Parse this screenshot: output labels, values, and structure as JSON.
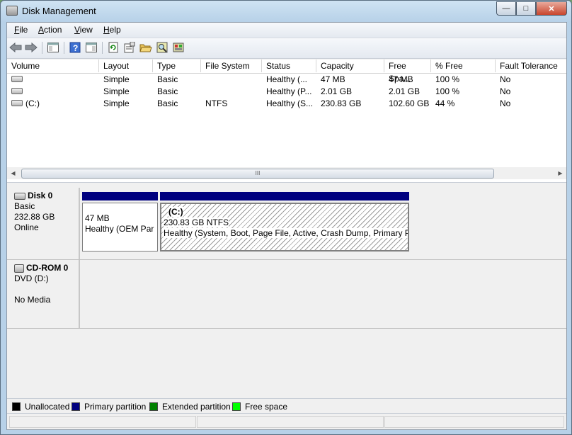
{
  "window": {
    "title": "Disk Management"
  },
  "menu": [
    {
      "label": "File",
      "key": "F"
    },
    {
      "label": "Action",
      "key": "A"
    },
    {
      "label": "View",
      "key": "V"
    },
    {
      "label": "Help",
      "key": "H"
    }
  ],
  "toolbar": [
    {
      "icon": "back-arrow-icon"
    },
    {
      "icon": "forward-arrow-icon"
    },
    {
      "icon": "show-hide-console-tree-icon"
    },
    {
      "icon": "help-icon"
    },
    {
      "icon": "properties-pane-icon"
    },
    {
      "icon": "refresh-icon"
    },
    {
      "icon": "properties-icon"
    },
    {
      "icon": "open-folder-icon"
    },
    {
      "icon": "explore-icon"
    },
    {
      "icon": "rescan-disks-icon"
    }
  ],
  "volumes": {
    "columns": [
      "Volume",
      "Layout",
      "Type",
      "File System",
      "Status",
      "Capacity",
      "Free Spa...",
      "% Free",
      "Fault Tolerance"
    ],
    "rows": [
      {
        "volume": "",
        "layout": "Simple",
        "type": "Basic",
        "fs": "",
        "status": "Healthy (...",
        "capacity": "47 MB",
        "free": "47 MB",
        "pct": "100 %",
        "fault": "No"
      },
      {
        "volume": "",
        "layout": "Simple",
        "type": "Basic",
        "fs": "",
        "status": "Healthy (P...",
        "capacity": "2.01 GB",
        "free": "2.01 GB",
        "pct": "100 %",
        "fault": "No"
      },
      {
        "volume": "(C:)",
        "layout": "Simple",
        "type": "Basic",
        "fs": "NTFS",
        "status": "Healthy (S...",
        "capacity": "230.83 GB",
        "free": "102.60 GB",
        "pct": "44 %",
        "fault": "No"
      }
    ]
  },
  "disks": [
    {
      "name": "Disk 0",
      "type": "Basic",
      "size": "232.88 GB",
      "state": "Online",
      "partitions": [
        {
          "line1": "47 MB",
          "line2": "Healthy (OEM Par"
        },
        {
          "title": "(C:)",
          "line1": "230.83 GB NTFS",
          "line2": "Healthy (System, Boot, Page File, Active, Crash Dump, Primary P"
        }
      ]
    },
    {
      "name": "CD-ROM 0",
      "type": "DVD (D:)",
      "state": "No Media"
    }
  ],
  "legend": [
    {
      "label": "Unallocated",
      "color": "#000000"
    },
    {
      "label": "Primary partition",
      "color": "#00007f"
    },
    {
      "label": "Extended partition",
      "color": "#008000"
    },
    {
      "label": "Free space",
      "color": "#00ff00"
    }
  ],
  "scrollbar": {
    "thumb_glyph": "III"
  }
}
